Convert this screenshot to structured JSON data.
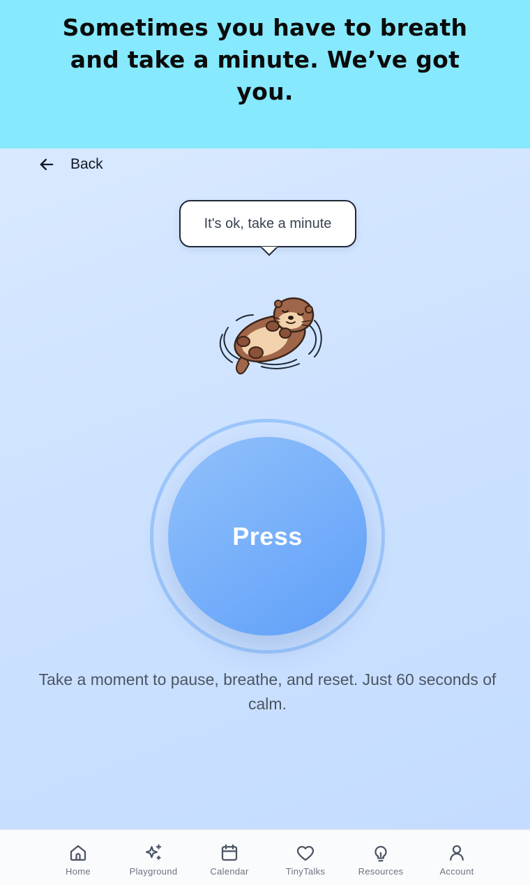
{
  "banner": {
    "headline": "Sometimes you have to breath and take a minute. We’ve got you."
  },
  "header": {
    "back_label": "Back",
    "back_icon": "arrow-left-icon"
  },
  "speech_bubble": {
    "text": "It's ok, take a minute"
  },
  "mascot": {
    "icon": "sleeping-otter-illustration"
  },
  "press_button": {
    "label": "Press"
  },
  "caption": {
    "text": "Take a moment to pause, breathe, and reset. Just 60 seconds of calm."
  },
  "tabbar": {
    "items": [
      {
        "label": "Home",
        "icon": "home-icon"
      },
      {
        "label": "Playground",
        "icon": "sparkles-icon"
      },
      {
        "label": "Calendar",
        "icon": "calendar-icon"
      },
      {
        "label": "TinyTalks",
        "icon": "heart-icon"
      },
      {
        "label": "Resources",
        "icon": "lightbulb-icon"
      },
      {
        "label": "Account",
        "icon": "user-icon"
      }
    ]
  },
  "colors": {
    "banner_bg": "#86e9fd",
    "screen_bg": "#cde2ff",
    "button": "#78b0fa",
    "ring": "#9cc6fb"
  }
}
